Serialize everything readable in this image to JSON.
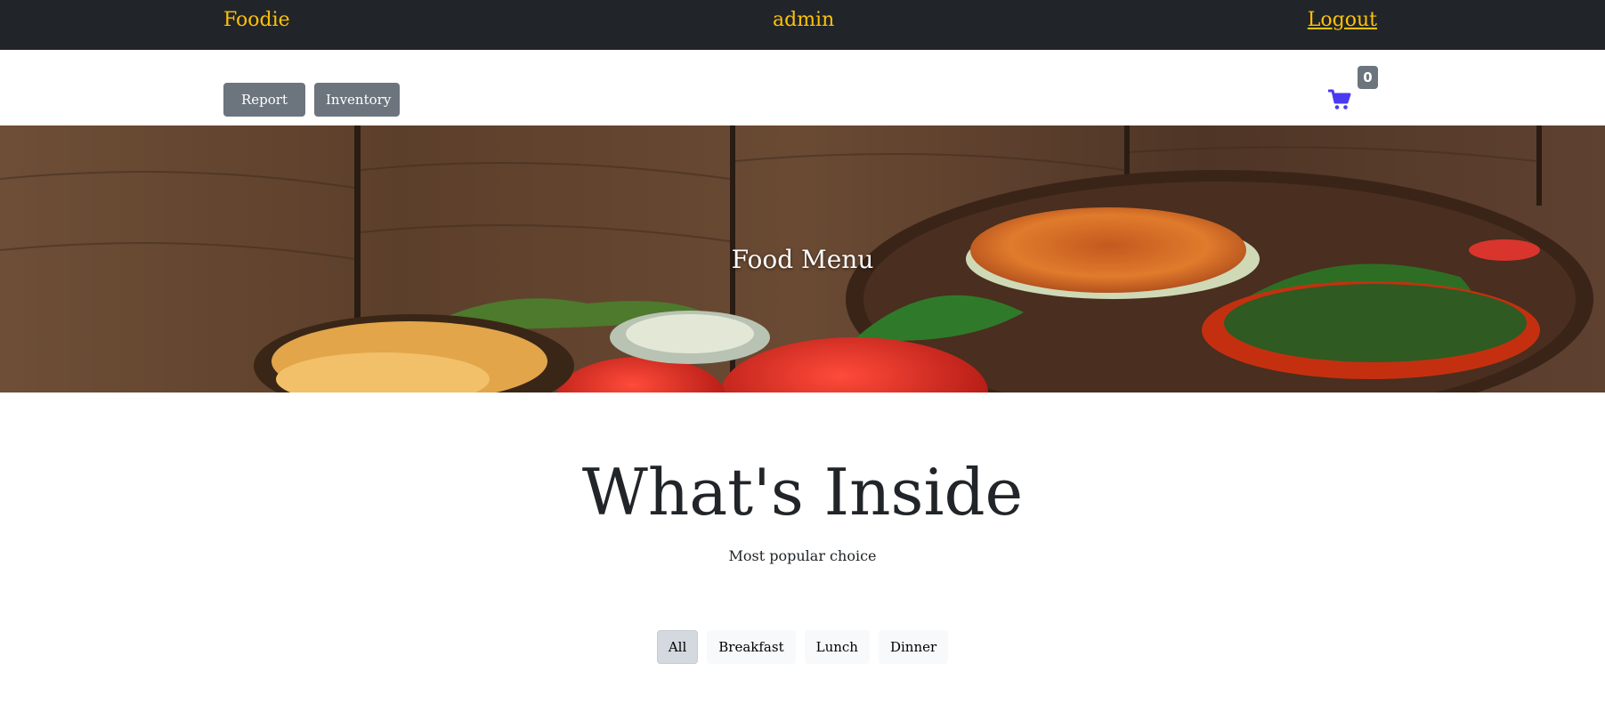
{
  "header": {
    "brand": "Foodie",
    "user": "admin",
    "logout": "Logout"
  },
  "toolbar": {
    "report_label": "Report",
    "inventory_label": "Inventory",
    "cart_count": "0"
  },
  "hero": {
    "title": "Food Menu"
  },
  "section": {
    "title": "What's Inside",
    "subtitle": "Most popular choice"
  },
  "filters": [
    {
      "label": "All",
      "active": true
    },
    {
      "label": "Breakfast",
      "active": false
    },
    {
      "label": "Lunch",
      "active": false
    },
    {
      "label": "Dinner",
      "active": false
    }
  ],
  "icons": {
    "cart": "shopping-cart-icon",
    "dropdown": "caret-down-icon"
  },
  "colors": {
    "topbar_bg": "#212529",
    "brand_accent": "#ffc107",
    "button_gray": "#6c757d",
    "cart_blue": "#4a3af0",
    "filter_bg": "#f8f9fa",
    "filter_active_bg": "#d3d9df"
  }
}
